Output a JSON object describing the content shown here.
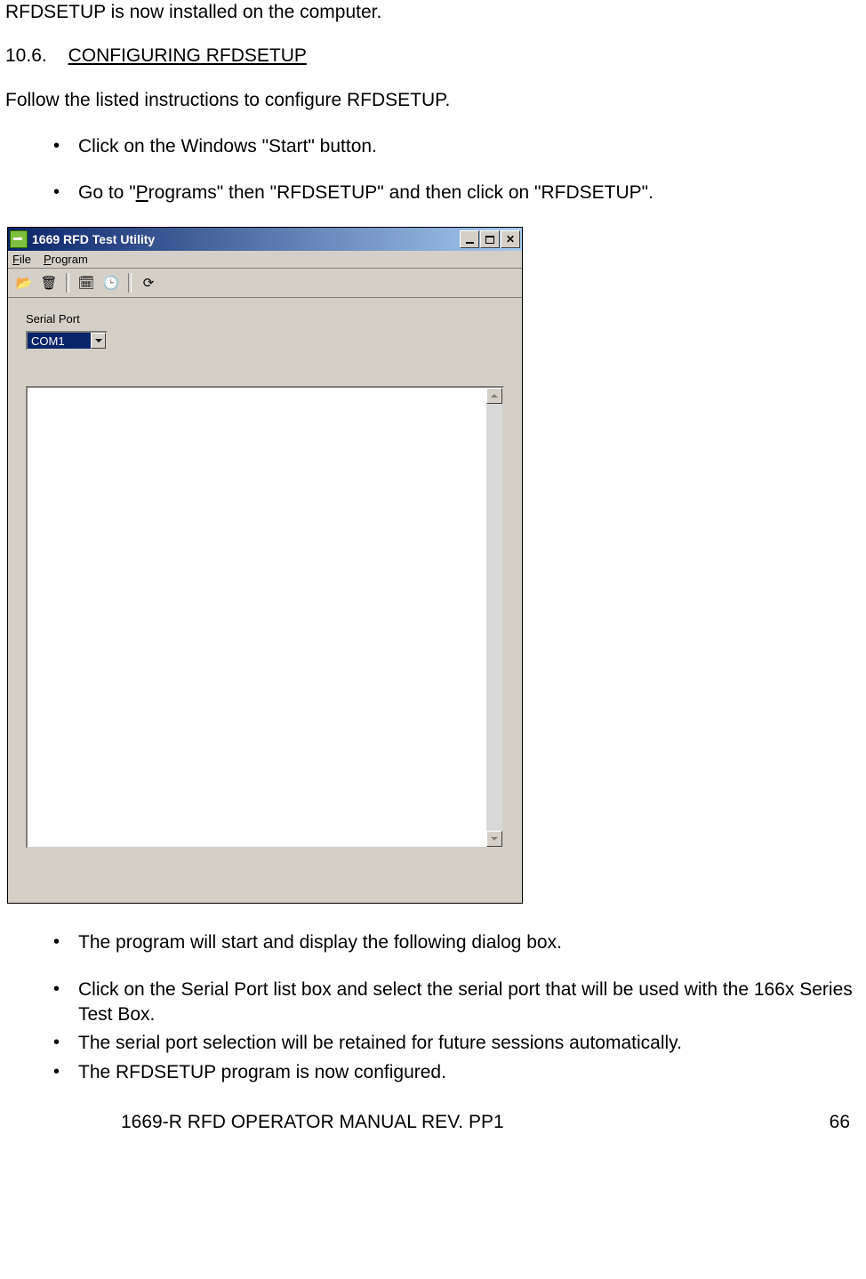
{
  "intro_text": "RFDSETUP is now installed on the computer.",
  "section": {
    "number": "10.6.",
    "title": "CONFIGURING RFDSETUP"
  },
  "follow_text": "Follow the listed instructions to configure RFDSETUP.",
  "bullets_top": [
    "Click on the Windows \"Start\" button."
  ],
  "bullet_goto": {
    "pre": "Go to \"",
    "p_underline": "P",
    "post": "rograms\" then \"RFDSETUP\" and then click on \"RFDSETUP\"."
  },
  "window": {
    "title": "1669 RFD Test Utility",
    "menus": {
      "file": {
        "u": "F",
        "rest": "ile"
      },
      "program": {
        "u": "P",
        "rest": "rogram"
      }
    },
    "serial_port_label": "Serial Port",
    "serial_port_value": "COM1"
  },
  "bullets_bottom_spaced": [
    "The program will start and display the following dialog box."
  ],
  "bullets_bottom_tight": [
    "Click on the Serial Port list box and select the serial port that will be used with the 166x Series Test Box.",
    "The serial port selection will be retained for future sessions automatically.",
    "The RFDSETUP program is now configured."
  ],
  "footer": {
    "title": "1669-R RFD OPERATOR MANUAL REV. PP1",
    "page": "66"
  }
}
